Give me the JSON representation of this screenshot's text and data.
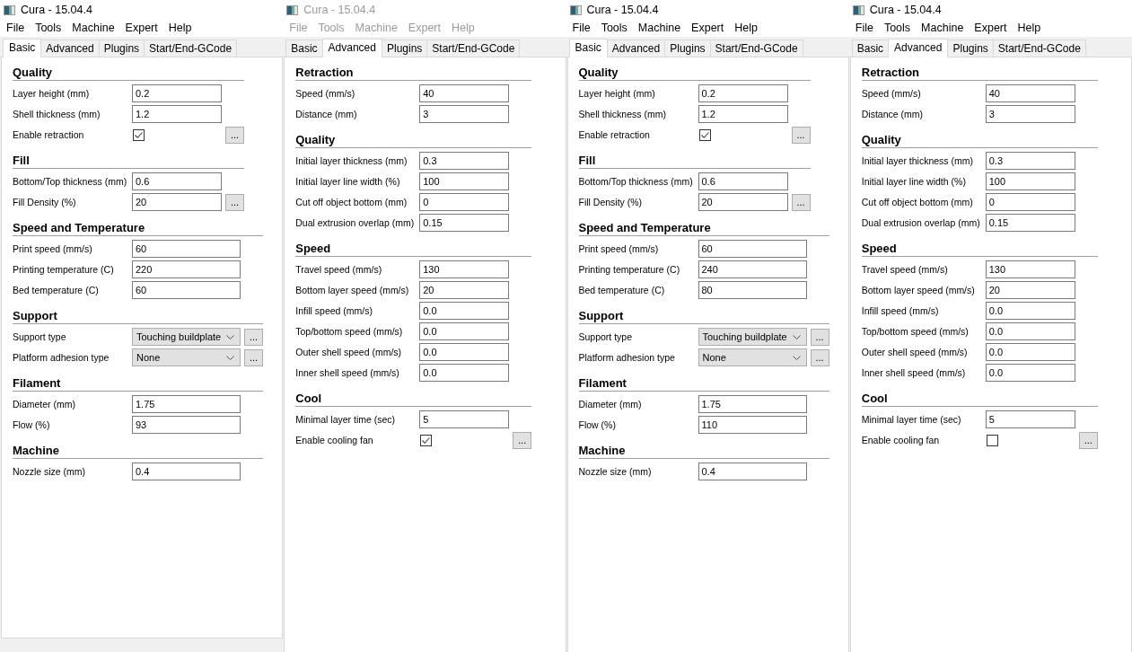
{
  "windows": [
    {
      "title": "Cura - 15.04.4",
      "active": true,
      "menu": [
        "File",
        "Tools",
        "Machine",
        "Expert",
        "Help"
      ],
      "tabs": [
        {
          "label": "Basic",
          "selected": true
        },
        {
          "label": "Advanced",
          "selected": false
        },
        {
          "label": "Plugins",
          "selected": false
        },
        {
          "label": "Start/End-GCode",
          "selected": false
        }
      ],
      "sections": [
        {
          "heading": "Quality",
          "rows": [
            {
              "kind": "text",
              "label": "Layer height (mm)",
              "value": "0.2"
            },
            {
              "kind": "text",
              "label": "Shell thickness (mm)",
              "value": "1.2"
            },
            {
              "kind": "checkbox",
              "label": "Enable retraction",
              "checked": true,
              "button": "..."
            }
          ]
        },
        {
          "heading": "Fill",
          "rows": [
            {
              "kind": "text",
              "label": "Bottom/Top thickness (mm)",
              "value": "0.6"
            },
            {
              "kind": "text",
              "label": "Fill Density (%)",
              "value": "20",
              "button": "..."
            }
          ]
        },
        {
          "heading": "Speed and Temperature",
          "rows": [
            {
              "kind": "text",
              "label": "Print speed (mm/s)",
              "value": "60"
            },
            {
              "kind": "text",
              "label": "Printing temperature (C)",
              "value": "220"
            },
            {
              "kind": "text",
              "label": "Bed temperature (C)",
              "value": "60"
            }
          ]
        },
        {
          "heading": "Support",
          "rows": [
            {
              "kind": "select",
              "label": "Support type",
              "value": "Touching buildplate",
              "button": "..."
            },
            {
              "kind": "select",
              "label": "Platform adhesion type",
              "value": "None",
              "button": "..."
            }
          ]
        },
        {
          "heading": "Filament",
          "rows": [
            {
              "kind": "text",
              "label": "Diameter (mm)",
              "value": "1.75"
            },
            {
              "kind": "text",
              "label": "Flow (%)",
              "value": "93"
            }
          ]
        },
        {
          "heading": "Machine",
          "rows": [
            {
              "kind": "text",
              "label": "Nozzle size (mm)",
              "value": "0.4"
            }
          ]
        }
      ]
    },
    {
      "title": "Cura - 15.04.4",
      "active": false,
      "menu": [
        "File",
        "Tools",
        "Machine",
        "Expert",
        "Help"
      ],
      "tabs": [
        {
          "label": "Basic",
          "selected": false
        },
        {
          "label": "Advanced",
          "selected": true
        },
        {
          "label": "Plugins",
          "selected": false
        },
        {
          "label": "Start/End-GCode",
          "selected": false
        }
      ],
      "sections": [
        {
          "heading": "Retraction",
          "rows": [
            {
              "kind": "text",
              "label": "Speed (mm/s)",
              "value": "40"
            },
            {
              "kind": "text",
              "label": "Distance (mm)",
              "value": "3"
            }
          ]
        },
        {
          "heading": "Quality",
          "rows": [
            {
              "kind": "text",
              "label": "Initial layer thickness (mm)",
              "value": "0.3"
            },
            {
              "kind": "text",
              "label": "Initial layer line width (%)",
              "value": "100"
            },
            {
              "kind": "text",
              "label": "Cut off object bottom (mm)",
              "value": "0"
            },
            {
              "kind": "text",
              "label": "Dual extrusion overlap (mm)",
              "value": "0.15"
            }
          ]
        },
        {
          "heading": "Speed",
          "rows": [
            {
              "kind": "text",
              "label": "Travel speed (mm/s)",
              "value": "130"
            },
            {
              "kind": "text",
              "label": "Bottom layer speed (mm/s)",
              "value": "20"
            },
            {
              "kind": "text",
              "label": "Infill speed (mm/s)",
              "value": "0.0"
            },
            {
              "kind": "text",
              "label": "Top/bottom speed (mm/s)",
              "value": "0.0"
            },
            {
              "kind": "text",
              "label": "Outer shell speed (mm/s)",
              "value": "0.0"
            },
            {
              "kind": "text",
              "label": "Inner shell speed (mm/s)",
              "value": "0.0"
            }
          ]
        },
        {
          "heading": "Cool",
          "rows": [
            {
              "kind": "text",
              "label": "Minimal layer time (sec)",
              "value": "5"
            },
            {
              "kind": "checkbox",
              "label": "Enable cooling fan",
              "checked": true,
              "button": "..."
            }
          ]
        }
      ]
    },
    {
      "title": "Cura - 15.04.4",
      "active": true,
      "menu": [
        "File",
        "Tools",
        "Machine",
        "Expert",
        "Help"
      ],
      "tabs": [
        {
          "label": "Basic",
          "selected": true
        },
        {
          "label": "Advanced",
          "selected": false
        },
        {
          "label": "Plugins",
          "selected": false
        },
        {
          "label": "Start/End-GCode",
          "selected": false
        }
      ],
      "sections": [
        {
          "heading": "Quality",
          "rows": [
            {
              "kind": "text",
              "label": "Layer height (mm)",
              "value": "0.2"
            },
            {
              "kind": "text",
              "label": "Shell thickness (mm)",
              "value": "1.2"
            },
            {
              "kind": "checkbox",
              "label": "Enable retraction",
              "checked": true,
              "button": "..."
            }
          ]
        },
        {
          "heading": "Fill",
          "rows": [
            {
              "kind": "text",
              "label": "Bottom/Top thickness (mm)",
              "value": "0.6"
            },
            {
              "kind": "text",
              "label": "Fill Density (%)",
              "value": "20",
              "button": "..."
            }
          ]
        },
        {
          "heading": "Speed and Temperature",
          "rows": [
            {
              "kind": "text",
              "label": "Print speed (mm/s)",
              "value": "60"
            },
            {
              "kind": "text",
              "label": "Printing temperature (C)",
              "value": "240"
            },
            {
              "kind": "text",
              "label": "Bed temperature (C)",
              "value": "80"
            }
          ]
        },
        {
          "heading": "Support",
          "rows": [
            {
              "kind": "select",
              "label": "Support type",
              "value": "Touching buildplate",
              "button": "..."
            },
            {
              "kind": "select",
              "label": "Platform adhesion type",
              "value": "None",
              "button": "..."
            }
          ]
        },
        {
          "heading": "Filament",
          "rows": [
            {
              "kind": "text",
              "label": "Diameter (mm)",
              "value": "1.75"
            },
            {
              "kind": "text",
              "label": "Flow (%)",
              "value": "110"
            }
          ]
        },
        {
          "heading": "Machine",
          "rows": [
            {
              "kind": "text",
              "label": "Nozzle size (mm)",
              "value": "0.4"
            }
          ]
        }
      ]
    },
    {
      "title": "Cura - 15.04.4",
      "active": true,
      "menu": [
        "File",
        "Tools",
        "Machine",
        "Expert",
        "Help"
      ],
      "tabs": [
        {
          "label": "Basic",
          "selected": false
        },
        {
          "label": "Advanced",
          "selected": true
        },
        {
          "label": "Plugins",
          "selected": false
        },
        {
          "label": "Start/End-GCode",
          "selected": false
        }
      ],
      "sections": [
        {
          "heading": "Retraction",
          "rows": [
            {
              "kind": "text",
              "label": "Speed (mm/s)",
              "value": "40"
            },
            {
              "kind": "text",
              "label": "Distance (mm)",
              "value": "3"
            }
          ]
        },
        {
          "heading": "Quality",
          "rows": [
            {
              "kind": "text",
              "label": "Initial layer thickness (mm)",
              "value": "0.3"
            },
            {
              "kind": "text",
              "label": "Initial layer line width (%)",
              "value": "100"
            },
            {
              "kind": "text",
              "label": "Cut off object bottom (mm)",
              "value": "0"
            },
            {
              "kind": "text",
              "label": "Dual extrusion overlap (mm)",
              "value": "0.15"
            }
          ]
        },
        {
          "heading": "Speed",
          "rows": [
            {
              "kind": "text",
              "label": "Travel speed (mm/s)",
              "value": "130"
            },
            {
              "kind": "text",
              "label": "Bottom layer speed (mm/s)",
              "value": "20"
            },
            {
              "kind": "text",
              "label": "Infill speed (mm/s)",
              "value": "0.0"
            },
            {
              "kind": "text",
              "label": "Top/bottom speed (mm/s)",
              "value": "0.0"
            },
            {
              "kind": "text",
              "label": "Outer shell speed (mm/s)",
              "value": "0.0"
            },
            {
              "kind": "text",
              "label": "Inner shell speed (mm/s)",
              "value": "0.0"
            }
          ]
        },
        {
          "heading": "Cool",
          "rows": [
            {
              "kind": "text",
              "label": "Minimal layer time (sec)",
              "value": "5"
            },
            {
              "kind": "checkbox",
              "label": "Enable cooling fan",
              "checked": false,
              "button": "..."
            }
          ]
        }
      ]
    }
  ]
}
